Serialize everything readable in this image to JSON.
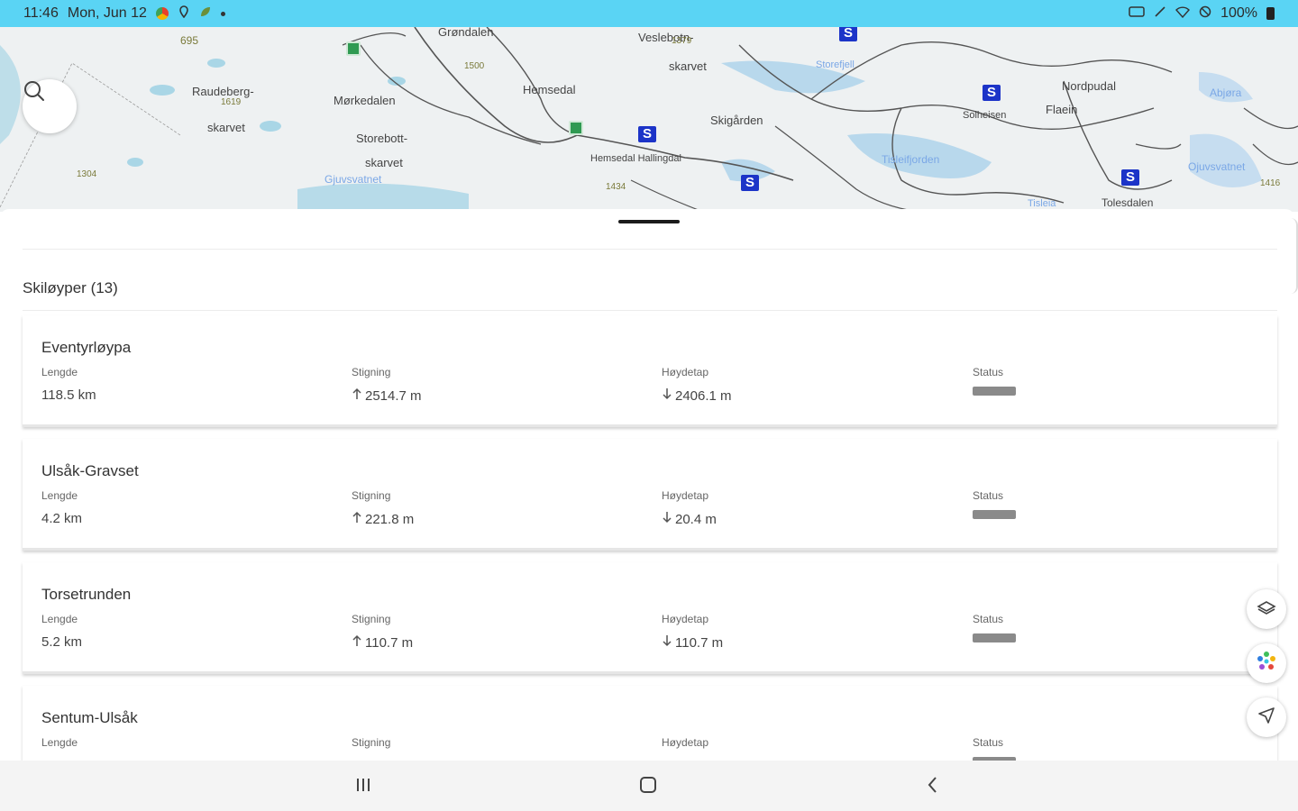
{
  "status_bar": {
    "time": "11:46",
    "date": "Mon, Jun 12",
    "battery": "100%",
    "icons": [
      "app-notification-icon",
      "location-icon",
      "leaf-icon",
      "dot-icon",
      "cast-icon",
      "mute-icon",
      "wifi-icon",
      "do-not-disturb-icon",
      "battery-icon"
    ]
  },
  "map": {
    "labels": {
      "grondalen": "Grøndalen",
      "vesleboten": "Veslebotn-",
      "skarvet_top": "skarvet",
      "raudeberg": "Raudeberg-",
      "raudeberg2": "skarvet",
      "mokedalen": "Mørkedalen",
      "storebott": "Storebott-",
      "storebott2": "skarvet",
      "hemsedal": "Hemsedal",
      "hemsedal_hallingdal": "Hemsedal Hallingdal",
      "skigaarden": "Skigården",
      "storefjell": "Storefjell",
      "flaein": "Flaein",
      "nordpudal": "Nordpudal",
      "solheisen": "Solheisen",
      "tolesdalen": "Tolesdalen",
      "gjuvsvatnet": "Gjuvsvatnet",
      "ojuvsvatnet": "Ojuvsvatnet",
      "abjora": "Abjøra",
      "tisleia": "Tisleia",
      "tisleifjorden": "Tisleifjorden",
      "peak1": "1304",
      "peak2": "1500",
      "peak3": "1434",
      "peak4": "1619",
      "peak5": "1379",
      "peak6": "695",
      "peak7": "1416"
    }
  },
  "sheet": {
    "section_title": "Skiløyper (13)",
    "headers": {
      "length": "Lengde",
      "climb": "Stigning",
      "descent": "Høydetap",
      "status": "Status"
    },
    "trails": [
      {
        "name": "Eventyrløypa",
        "length": "118.5 km",
        "climb": "2514.7 m",
        "descent": "2406.1 m"
      },
      {
        "name": "Ulsåk-Gravset",
        "length": "4.2 km",
        "climb": "221.8 m",
        "descent": "20.4 m"
      },
      {
        "name": "Torsetrunden",
        "length": "5.2 km",
        "climb": "110.7 m",
        "descent": "110.7 m"
      },
      {
        "name": "Sentum-Ulsåk",
        "length": "",
        "climb": "",
        "descent": ""
      }
    ]
  },
  "fabs": [
    "layers-icon",
    "palette-icon",
    "navigation-icon"
  ],
  "nav": [
    "recent-apps-icon",
    "home-icon",
    "back-icon"
  ]
}
